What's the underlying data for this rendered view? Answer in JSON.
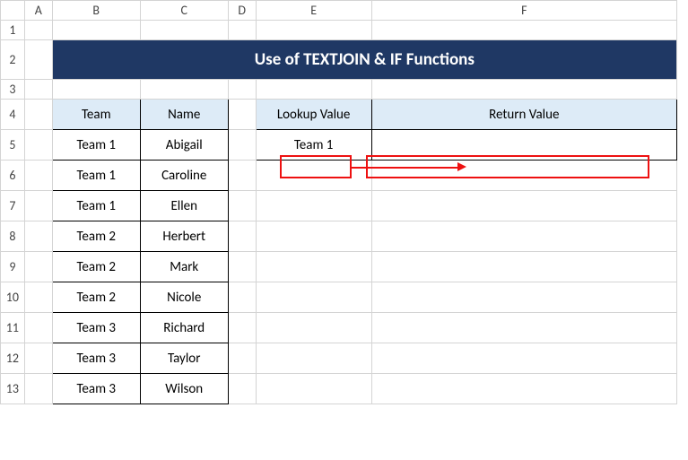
{
  "columns": [
    "",
    "A",
    "B",
    "C",
    "D",
    "E",
    "F"
  ],
  "rows": [
    "1",
    "2",
    "3",
    "4",
    "5",
    "6",
    "7",
    "8",
    "9",
    "10",
    "11",
    "12",
    "13"
  ],
  "title": "Use of TEXTJOIN & IF Functions",
  "table1": {
    "headers": {
      "team": "Team",
      "name": "Name"
    },
    "rows": [
      {
        "team": "Team 1",
        "name": "Abigail"
      },
      {
        "team": "Team 1",
        "name": "Caroline"
      },
      {
        "team": "Team 1",
        "name": "Ellen"
      },
      {
        "team": "Team 2",
        "name": "Herbert"
      },
      {
        "team": "Team 2",
        "name": "Mark"
      },
      {
        "team": "Team 2",
        "name": "Nicole"
      },
      {
        "team": "Team 3",
        "name": "Richard"
      },
      {
        "team": "Team 3",
        "name": "Taylor"
      },
      {
        "team": "Team 3",
        "name": "Wilson"
      }
    ]
  },
  "table2": {
    "headers": {
      "lookup": "Lookup Value",
      "return": "Return Value"
    },
    "lookup_value": "Team 1",
    "return_value": ""
  }
}
